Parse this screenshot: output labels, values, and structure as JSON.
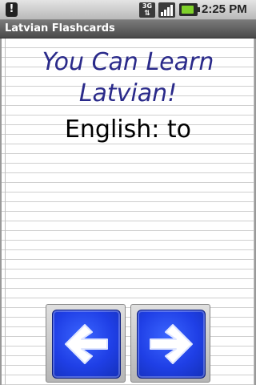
{
  "status_bar": {
    "clock": "2:25 PM",
    "notification_icon": "alert-icon",
    "network_label": "3G"
  },
  "app": {
    "title": "Latvian Flashcards"
  },
  "card": {
    "headline": "You Can Learn Latvian!",
    "word": "English: to"
  },
  "navigation": {
    "prev_icon": "arrow-left-icon",
    "next_icon": "arrow-right-icon"
  },
  "colors": {
    "headline": "#2a2a8a",
    "button_face": "#1f3fe6"
  }
}
